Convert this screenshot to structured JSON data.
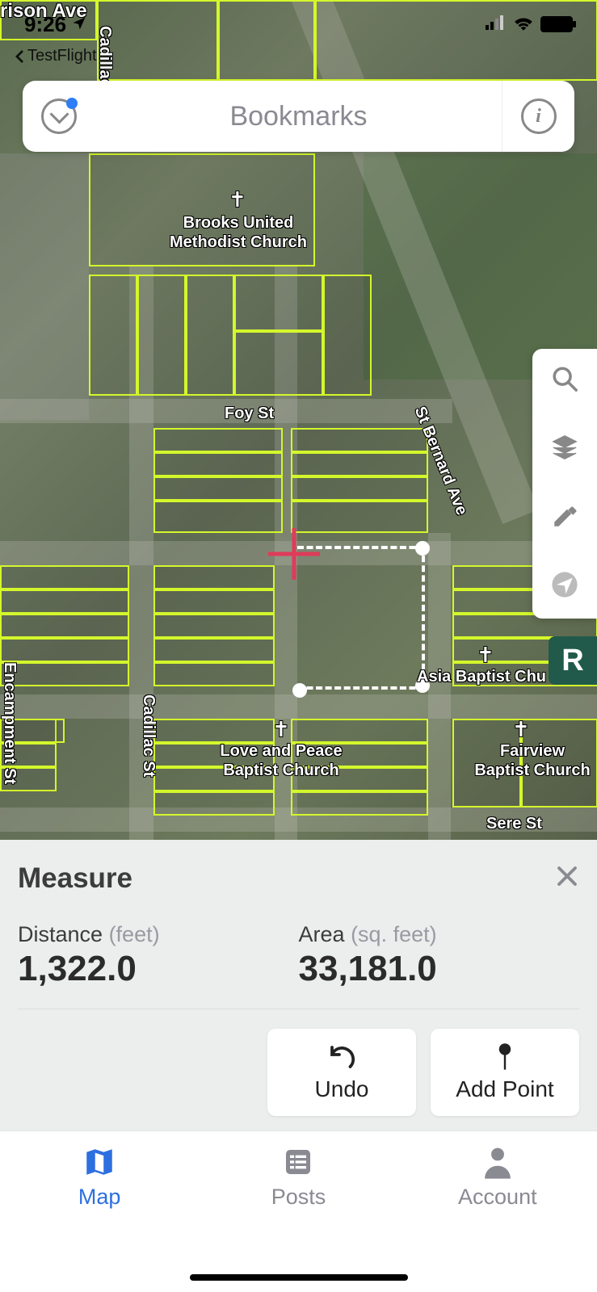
{
  "status": {
    "time": "9:26",
    "back_app": "TestFlight"
  },
  "topbar": {
    "title": "Bookmarks"
  },
  "map": {
    "labels": {
      "harrison": "rison Ave",
      "cadillac_top": "Cadillac St",
      "brooks": "Brooks United\nMethodist Church",
      "foy": "Foy St",
      "stbernard": "St Bernard Ave",
      "encampment": "Encampment St",
      "cadillac_bot": "Cadillac St",
      "love_peace": "Love and Peace\nBaptist Church",
      "asia": "Asia Baptist Chu",
      "fairview": "Fairview\nBaptist Church",
      "sere": "Sere St"
    }
  },
  "side_badge": "R",
  "measure": {
    "title": "Measure",
    "distance_label": "Distance",
    "distance_unit": "(feet)",
    "distance_value": "1,322.0",
    "area_label": "Area",
    "area_unit": "(sq. feet)",
    "area_value": "33,181.0",
    "undo": "Undo",
    "add_point": "Add Point"
  },
  "tabs": {
    "map": "Map",
    "posts": "Posts",
    "account": "Account"
  }
}
